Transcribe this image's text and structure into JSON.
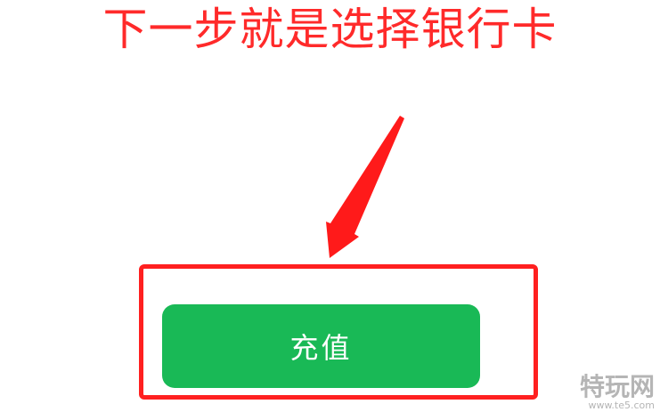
{
  "instruction": {
    "text": "下一步就是选择银行卡"
  },
  "button": {
    "label": "充值"
  },
  "watermark": {
    "brand": "特玩网",
    "url": "www.te5.com"
  },
  "colors": {
    "headline": "#ff2a2a",
    "highlight_border": "#ff2020",
    "button_bg": "#19b956",
    "button_text": "#ffffff",
    "arrow": "#ff1a1a"
  },
  "icons": {
    "pointer": "arrow-icon"
  }
}
